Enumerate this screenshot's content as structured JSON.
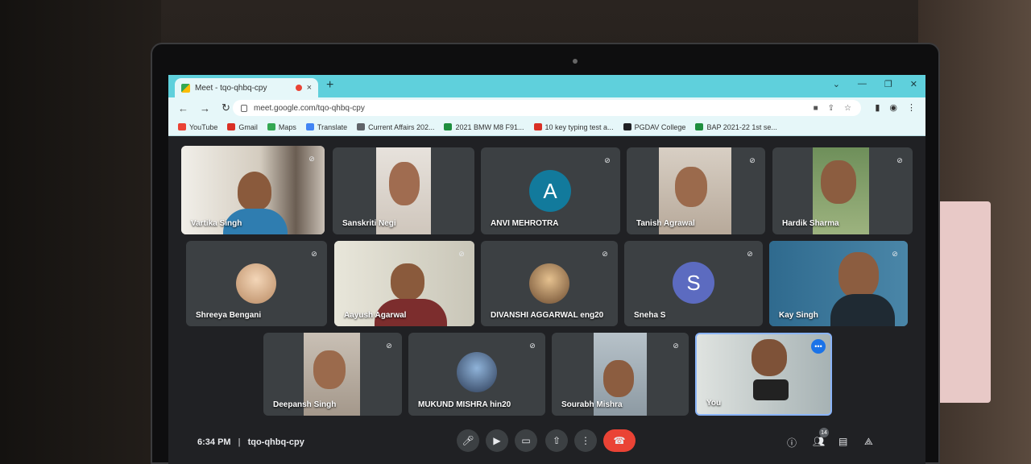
{
  "browser": {
    "tab_title": "Meet - tqo-qhbq-cpy",
    "tab_close": "×",
    "new_tab": "+",
    "url": "meet.google.com/tqo-qhbq-cpy",
    "window_controls": [
      "⌄",
      "—",
      "❐",
      "✕"
    ]
  },
  "bookmarks": [
    {
      "label": "YouTube",
      "color": "#ea4335"
    },
    {
      "label": "Gmail",
      "color": "#d93025"
    },
    {
      "label": "Maps",
      "color": "#34a853"
    },
    {
      "label": "Translate",
      "color": "#4285f4"
    },
    {
      "label": "Current Affairs 202...",
      "color": "#5f6368"
    },
    {
      "label": "2021 BMW M8 F91...",
      "color": "#1e8e3e"
    },
    {
      "label": "10 key typing test a...",
      "color": "#d93025"
    },
    {
      "label": "PGDAV College",
      "color": "#202124"
    },
    {
      "label": "BAP 2021-22 1st se...",
      "color": "#1e8e3e"
    }
  ],
  "participants": [
    {
      "name": "Vartika Singh",
      "muted": true
    },
    {
      "name": "Sanskriti Negi",
      "muted": false
    },
    {
      "name": "ANVI MEHROTRA",
      "muted": true,
      "letter": "A",
      "avatar_color": "#127a9c"
    },
    {
      "name": "Tanish Agrawal",
      "muted": true
    },
    {
      "name": "Hardik Sharma",
      "muted": true
    },
    {
      "name": "Shreeya Bengani",
      "muted": true
    },
    {
      "name": "Aayush Agarwal",
      "muted": true
    },
    {
      "name": "DIVANSHI AGGARWAL eng20",
      "muted": true
    },
    {
      "name": "Sneha S",
      "muted": true,
      "letter": "S",
      "avatar_color": "#5c6bc0"
    },
    {
      "name": "Kay Singh",
      "muted": true
    },
    {
      "name": "Deepansh Singh",
      "muted": true
    },
    {
      "name": "MUKUND MISHRA hin20",
      "muted": true
    },
    {
      "name": "Sourabh Mishra",
      "muted": true
    },
    {
      "name": "You",
      "muted": false
    }
  ],
  "meeting": {
    "time": "6:34 PM",
    "separator": "|",
    "code": "tqo-qhbq-cpy",
    "participant_count": "14"
  },
  "colors": {
    "end_call": "#ea4335",
    "active_tile_border": "#8ab4f8",
    "browser_theme": "#5fd0dc"
  }
}
